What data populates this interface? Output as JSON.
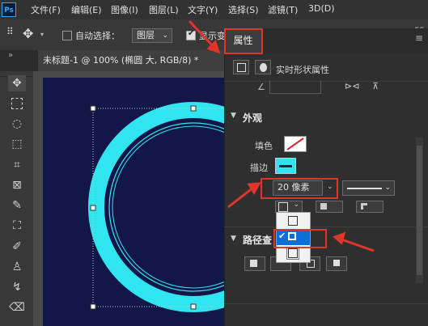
{
  "app": {
    "logo": "Ps"
  },
  "menu": [
    "文件(F)",
    "编辑(E)",
    "图像(I)",
    "图层(L)",
    "文字(Y)",
    "选择(S)",
    "滤镜(T)",
    "3D(D)"
  ],
  "options": {
    "move_icon": "move-icon",
    "auto_select_label": "自动选择：",
    "layer_dropdown": "图层",
    "show_transform_label": "显示变"
  },
  "document_tab": {
    "title": "未标题-1 @ 100% (椭圆 大, RGB/8) *"
  },
  "properties": {
    "tab_label": "属性",
    "live_shape_label": "实时形状属性",
    "appearance_label": "外观",
    "fill_label": "填色",
    "stroke_label": "描边",
    "stroke_width": "20 像素",
    "path_ops_label": "路径查",
    "align_popup": {
      "options": [
        "inside",
        "center",
        "outside"
      ],
      "selected": "center"
    }
  },
  "colors": {
    "stroke_color": "#30e4f0",
    "canvas_color": "#131748",
    "highlight_red": "#e0352b",
    "popup_selected": "#0a6fd6"
  }
}
